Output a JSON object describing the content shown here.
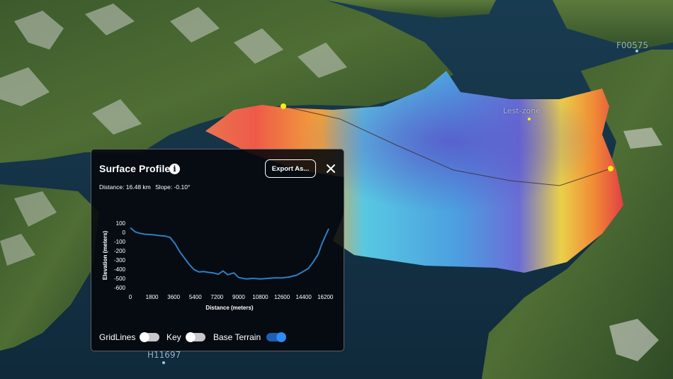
{
  "map": {
    "labels": [
      "F00575",
      "Lest-zone",
      "H11697"
    ]
  },
  "panel": {
    "title": "Surface Profile",
    "info_icon": "info-icon",
    "export_label": "Export As...",
    "close_icon": "close-icon",
    "distance_text": "Distance: 16.48 km",
    "slope_text": "Slope: -0.10°"
  },
  "toggles": {
    "gridlines": {
      "label": "GridLines",
      "on": false
    },
    "key": {
      "label": "Key",
      "on": false
    },
    "base_terrain": {
      "label": "Base Terrain",
      "on": true
    }
  },
  "chart_data": {
    "type": "line",
    "xlabel": "Distance (meters)",
    "ylabel": "Elevation (meters)",
    "xlim": [
      0,
      16480
    ],
    "ylim": [
      -600,
      100
    ],
    "x_ticks": [
      0,
      1800,
      3600,
      5400,
      7200,
      9000,
      10800,
      12600,
      14400,
      16200
    ],
    "y_ticks": [
      100,
      0,
      -100,
      -200,
      -300,
      -400,
      -500,
      -600
    ],
    "grid": false,
    "line_color": "#2d7fc4",
    "x": [
      0,
      400,
      800,
      1200,
      1800,
      2400,
      2900,
      3300,
      3700,
      4100,
      4500,
      4900,
      5300,
      5700,
      6100,
      6500,
      6900,
      7300,
      7700,
      8100,
      8600,
      9000,
      9600,
      10200,
      10800,
      11400,
      12000,
      12600,
      13200,
      13800,
      14300,
      14800,
      15200,
      15600,
      15900,
      16200,
      16480
    ],
    "y": [
      50,
      5,
      -10,
      -20,
      -25,
      -35,
      -40,
      -55,
      -120,
      -210,
      -280,
      -350,
      -405,
      -430,
      -425,
      -435,
      -440,
      -455,
      -420,
      -460,
      -440,
      -490,
      -505,
      -500,
      -505,
      -500,
      -495,
      -495,
      -485,
      -465,
      -430,
      -390,
      -320,
      -240,
      -130,
      -40,
      40
    ]
  }
}
